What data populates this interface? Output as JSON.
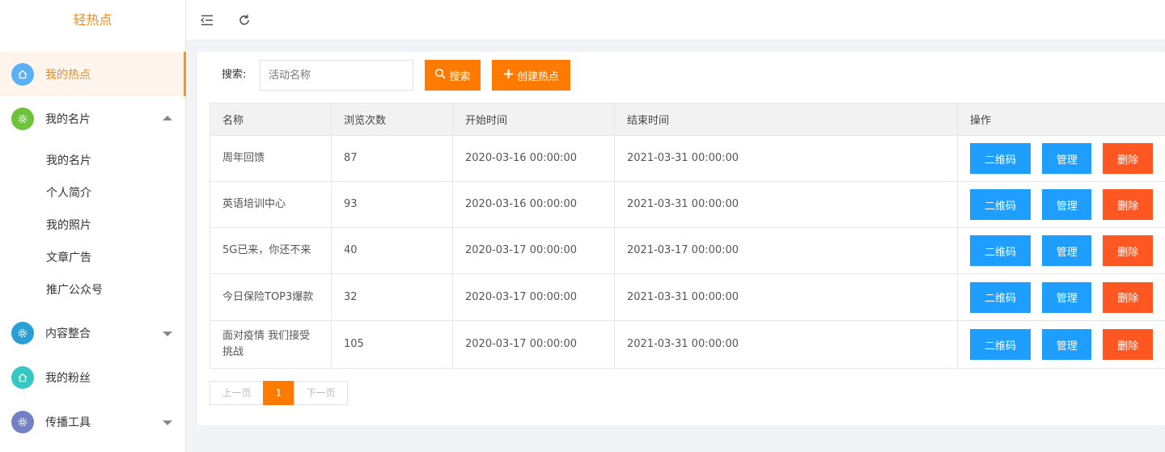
{
  "brand": "轻热点",
  "sidebar": {
    "items": [
      {
        "label": "我的热点",
        "icon": "home-icon",
        "color": "#5ab0f5"
      },
      {
        "label": "我的名片",
        "icon": "gear-icon",
        "color": "#6dc33a"
      },
      {
        "label": "内容整合",
        "icon": "gear-icon",
        "color": "#2b9ed4"
      },
      {
        "label": "我的粉丝",
        "icon": "home-icon",
        "color": "#35c7c2"
      },
      {
        "label": "传播工具",
        "icon": "gear-icon",
        "color": "#7580c4"
      }
    ],
    "sub_items": [
      "我的名片",
      "个人简介",
      "我的照片",
      "文章广告",
      "推广公众号"
    ]
  },
  "topbar": {
    "menu_icon": "menu-fold-icon",
    "refresh_icon": "refresh-icon"
  },
  "search": {
    "label": "搜索:",
    "placeholder": "活动名称",
    "search_button": "搜索",
    "create_button": "创建热点"
  },
  "table": {
    "headers": [
      "名称",
      "浏览次数",
      "开始时间",
      "结束时间",
      "操作"
    ],
    "rows": [
      {
        "name": "周年回馈",
        "views": "87",
        "start": "2020-03-16 00:00:00",
        "end": "2021-03-31 00:00:00"
      },
      {
        "name": "英语培训中心",
        "views": "93",
        "start": "2020-03-16 00:00:00",
        "end": "2021-03-31 00:00:00"
      },
      {
        "name": "5G已来，你还不来",
        "views": "40",
        "start": "2020-03-17 00:00:00",
        "end": "2021-03-17 00:00:00"
      },
      {
        "name": "今日保险TOP3爆款",
        "views": "32",
        "start": "2020-03-17 00:00:00",
        "end": "2021-03-31 00:00:00"
      },
      {
        "name": "面对疫情 我们接受挑战",
        "views": "105",
        "start": "2020-03-17 00:00:00",
        "end": "2021-03-31 00:00:00"
      }
    ],
    "actions": {
      "qr": "二维码",
      "manage": "管理",
      "delete": "删除"
    }
  },
  "pagination": {
    "prev": "上一页",
    "current": "1",
    "next": "下一页"
  },
  "colors": {
    "accent": "#ff7a00",
    "primary": "#1e9fff",
    "danger": "#ff5722"
  }
}
